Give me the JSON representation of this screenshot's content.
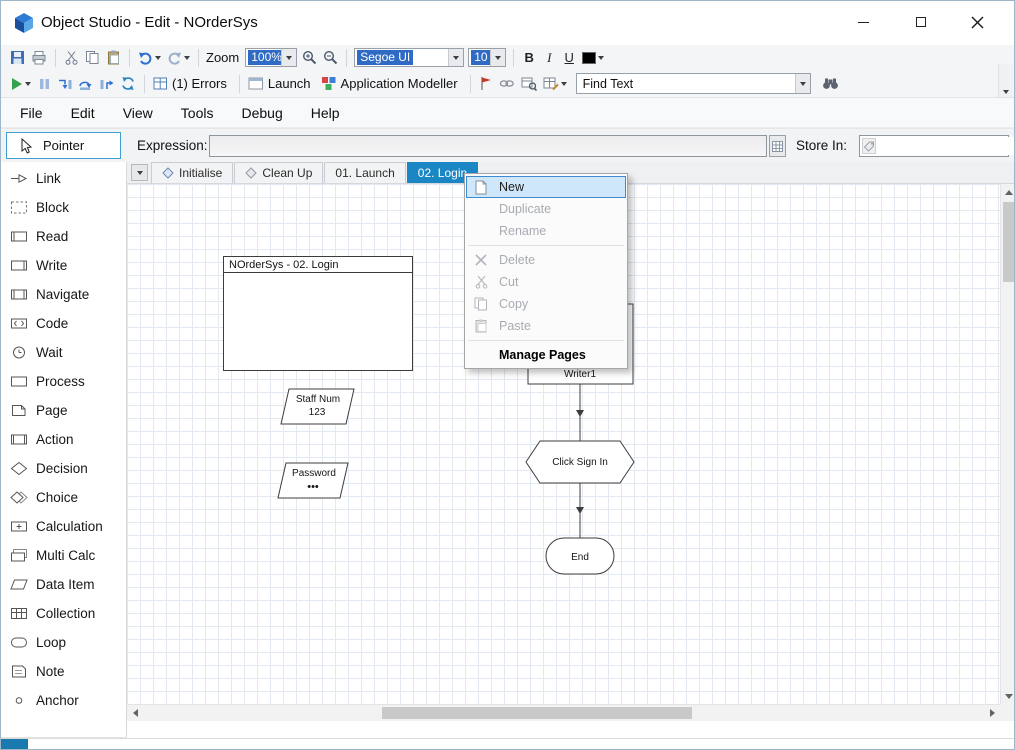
{
  "window": {
    "title": "Object Studio - Edit - NOrderSys"
  },
  "format_toolbar": {
    "zoom_label": "Zoom",
    "zoom_value": "100%",
    "font_family_value": "Segoe UI",
    "font_size_value": "10",
    "bold_label": "B",
    "italic_label": "I",
    "underline_label": "U"
  },
  "debug_toolbar": {
    "errors_label": "(1) Errors",
    "launch_label": "Launch",
    "application_modeller_label": "Application Modeller",
    "find_text_value": "Find Text"
  },
  "menubar": {
    "items": [
      {
        "label": "File"
      },
      {
        "label": "Edit"
      },
      {
        "label": "View"
      },
      {
        "label": "Tools"
      },
      {
        "label": "Debug"
      },
      {
        "label": "Help"
      }
    ]
  },
  "expression_bar": {
    "pointer_tool_label": "Pointer",
    "expression_label": "Expression:",
    "expression_value": "",
    "store_in_label": "Store In:",
    "store_in_value": ""
  },
  "tool_palette": {
    "items": [
      {
        "label": "Link",
        "icon": "link-icon"
      },
      {
        "label": "Block",
        "icon": "block-icon"
      },
      {
        "label": "Read",
        "icon": "read-icon"
      },
      {
        "label": "Write",
        "icon": "write-icon"
      },
      {
        "label": "Navigate",
        "icon": "navigate-icon"
      },
      {
        "label": "Code",
        "icon": "code-icon"
      },
      {
        "label": "Wait",
        "icon": "wait-icon"
      },
      {
        "label": "Process",
        "icon": "process-icon"
      },
      {
        "label": "Page",
        "icon": "page-icon"
      },
      {
        "label": "Action",
        "icon": "action-icon"
      },
      {
        "label": "Decision",
        "icon": "decision-icon"
      },
      {
        "label": "Choice",
        "icon": "choice-icon"
      },
      {
        "label": "Calculation",
        "icon": "calculation-icon"
      },
      {
        "label": "Multi Calc",
        "icon": "multi-calc-icon"
      },
      {
        "label": "Data Item",
        "icon": "data-item-icon"
      },
      {
        "label": "Collection",
        "icon": "collection-icon"
      },
      {
        "label": "Loop",
        "icon": "loop-icon"
      },
      {
        "label": "Note",
        "icon": "note-icon"
      },
      {
        "label": "Anchor",
        "icon": "anchor-icon"
      }
    ]
  },
  "page_tabs": {
    "items": [
      {
        "label": "Initialise",
        "active": false
      },
      {
        "label": "Clean Up",
        "active": false
      },
      {
        "label": "01. Launch",
        "active": false
      },
      {
        "label": "02. Login",
        "active": true
      }
    ]
  },
  "canvas": {
    "page_description": "NOrderSys - 02. Login",
    "data_items": [
      {
        "name": "Staff Num",
        "value": "123"
      },
      {
        "name": "Password",
        "value": "•••"
      }
    ],
    "stages": [
      {
        "label": "Writer1",
        "type": "write"
      },
      {
        "label": "Click Sign In",
        "type": "wait"
      },
      {
        "label": "End",
        "type": "end"
      }
    ]
  },
  "context_menu": {
    "items": [
      {
        "label": "New",
        "state": "highlighted"
      },
      {
        "label": "Duplicate",
        "state": "disabled"
      },
      {
        "label": "Rename",
        "state": "disabled"
      },
      {
        "label": "Delete",
        "state": "disabled"
      },
      {
        "label": "Cut",
        "state": "disabled"
      },
      {
        "label": "Copy",
        "state": "disabled"
      },
      {
        "label": "Paste",
        "state": "disabled"
      },
      {
        "label": "Manage Pages",
        "state": "enabled"
      }
    ]
  },
  "colors": {
    "active_tab_blue": "#1b86c4",
    "selection_blue": "#2f6ac5",
    "menu_highlight": "#cfe7fb",
    "menu_highlight_border": "#3d8ad0",
    "play_green": "#35a24c",
    "flag_red": "#c0392b",
    "status_accent_blue": "#1a7ab0"
  }
}
